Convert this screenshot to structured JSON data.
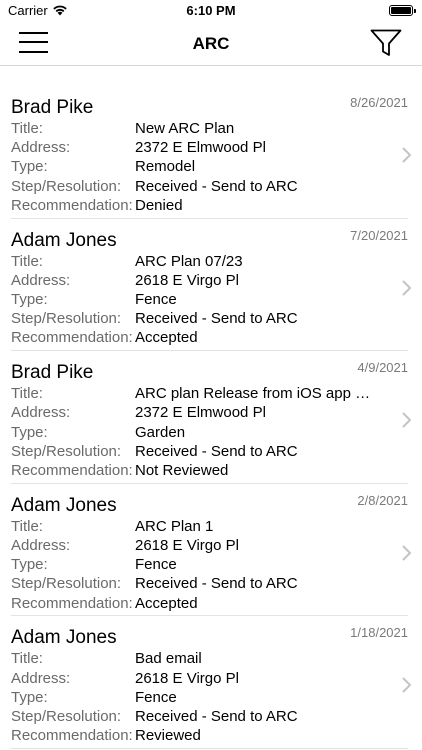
{
  "status": {
    "carrier": "Carrier",
    "time": "6:10 PM"
  },
  "nav": {
    "title": "ARC",
    "menu_icon": "hamburger-menu-icon",
    "filter_icon": "filter-icon"
  },
  "labels": {
    "title": "Title:",
    "address": "Address:",
    "type": "Type:",
    "step": "Step/Resolution:",
    "recommendation": "Recommendation:"
  },
  "items": [
    {
      "name": "Brad Pike",
      "date": "8/26/2021",
      "title": "New ARC Plan",
      "address": "2372 E Elmwood Pl",
      "type": "Remodel",
      "step": "Received - Send to ARC",
      "recommendation": "Denied"
    },
    {
      "name": "Adam Jones",
      "date": "7/20/2021",
      "title": "ARC Plan 07/23",
      "address": "2618 E Virgo Pl",
      "type": "Fence",
      "step": "Received - Send to ARC",
      "recommendation": "Accepted"
    },
    {
      "name": "Brad Pike",
      "date": "4/9/2021",
      "title": "ARC plan Release from iOS app C...",
      "address": "2372 E Elmwood Pl",
      "type": "Garden",
      "step": "Received - Send to ARC",
      "recommendation": "Not Reviewed"
    },
    {
      "name": "Adam Jones",
      "date": "2/8/2021",
      "title": "ARC Plan 1",
      "address": "2618 E Virgo Pl",
      "type": "Fence",
      "step": "Received - Send to ARC",
      "recommendation": "Accepted"
    },
    {
      "name": "Adam Jones",
      "date": "1/18/2021",
      "title": "Bad email",
      "address": "2618 E Virgo Pl",
      "type": "Fence",
      "step": "Received - Send to ARC",
      "recommendation": "Reviewed"
    }
  ]
}
